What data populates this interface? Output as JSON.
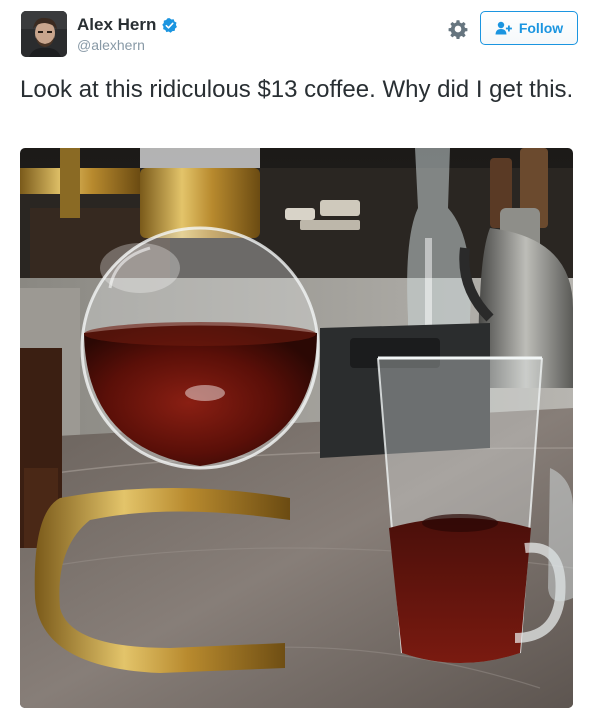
{
  "tweet": {
    "author": {
      "display_name": "Alex Hern",
      "handle": "@alexhern",
      "verified": true,
      "avatar_icon": "avatar-photo"
    },
    "actions": {
      "settings_icon": "gear-icon",
      "follow_label": "Follow",
      "follow_icon": "add-user-icon"
    },
    "text": "Look at this ridiculous $13 coffee. Why did I get this.",
    "media": {
      "type": "photo",
      "icon": "photo-syphon-coffee"
    }
  },
  "colors": {
    "accent": "#1b95e0",
    "text": "#292f33",
    "secondary_text": "#8899a6",
    "gear": "#66757f"
  }
}
